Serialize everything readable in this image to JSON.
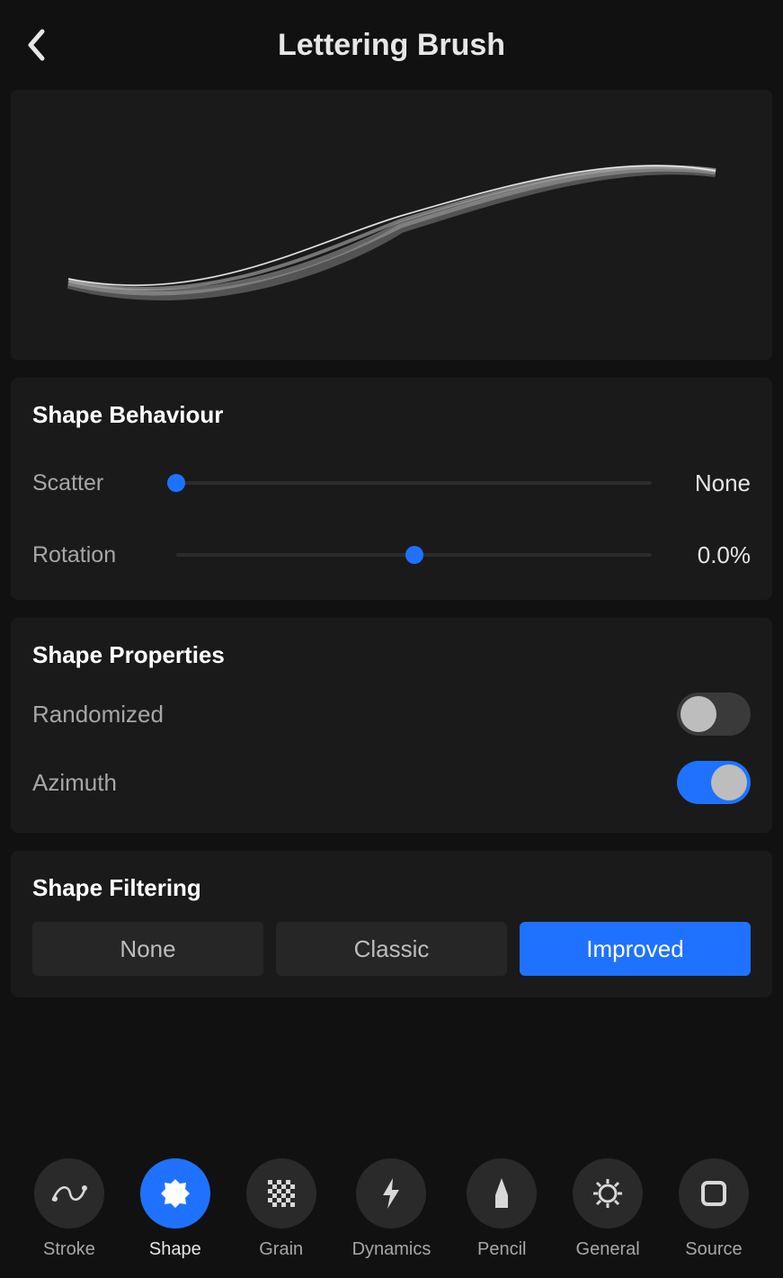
{
  "header": {
    "title": "Lettering Brush"
  },
  "behaviour": {
    "title": "Shape Behaviour",
    "scatter": {
      "label": "Scatter",
      "value": "None",
      "percent": 0
    },
    "rotation": {
      "label": "Rotation",
      "value": "0.0%",
      "percent": 50
    }
  },
  "properties": {
    "title": "Shape Properties",
    "randomized": {
      "label": "Randomized",
      "on": false
    },
    "azimuth": {
      "label": "Azimuth",
      "on": true
    }
  },
  "filtering": {
    "title": "Shape Filtering",
    "options": [
      "None",
      "Classic",
      "Improved"
    ],
    "selected": "Improved"
  },
  "tabs": [
    {
      "id": "stroke",
      "label": "Stroke",
      "icon": "stroke-icon"
    },
    {
      "id": "shape",
      "label": "Shape",
      "icon": "shape-icon",
      "active": true
    },
    {
      "id": "grain",
      "label": "Grain",
      "icon": "grain-icon"
    },
    {
      "id": "dynamics",
      "label": "Dynamics",
      "icon": "dynamics-icon"
    },
    {
      "id": "pencil",
      "label": "Pencil",
      "icon": "pencil-icon"
    },
    {
      "id": "general",
      "label": "General",
      "icon": "general-icon"
    },
    {
      "id": "source",
      "label": "Source",
      "icon": "source-icon"
    }
  ]
}
